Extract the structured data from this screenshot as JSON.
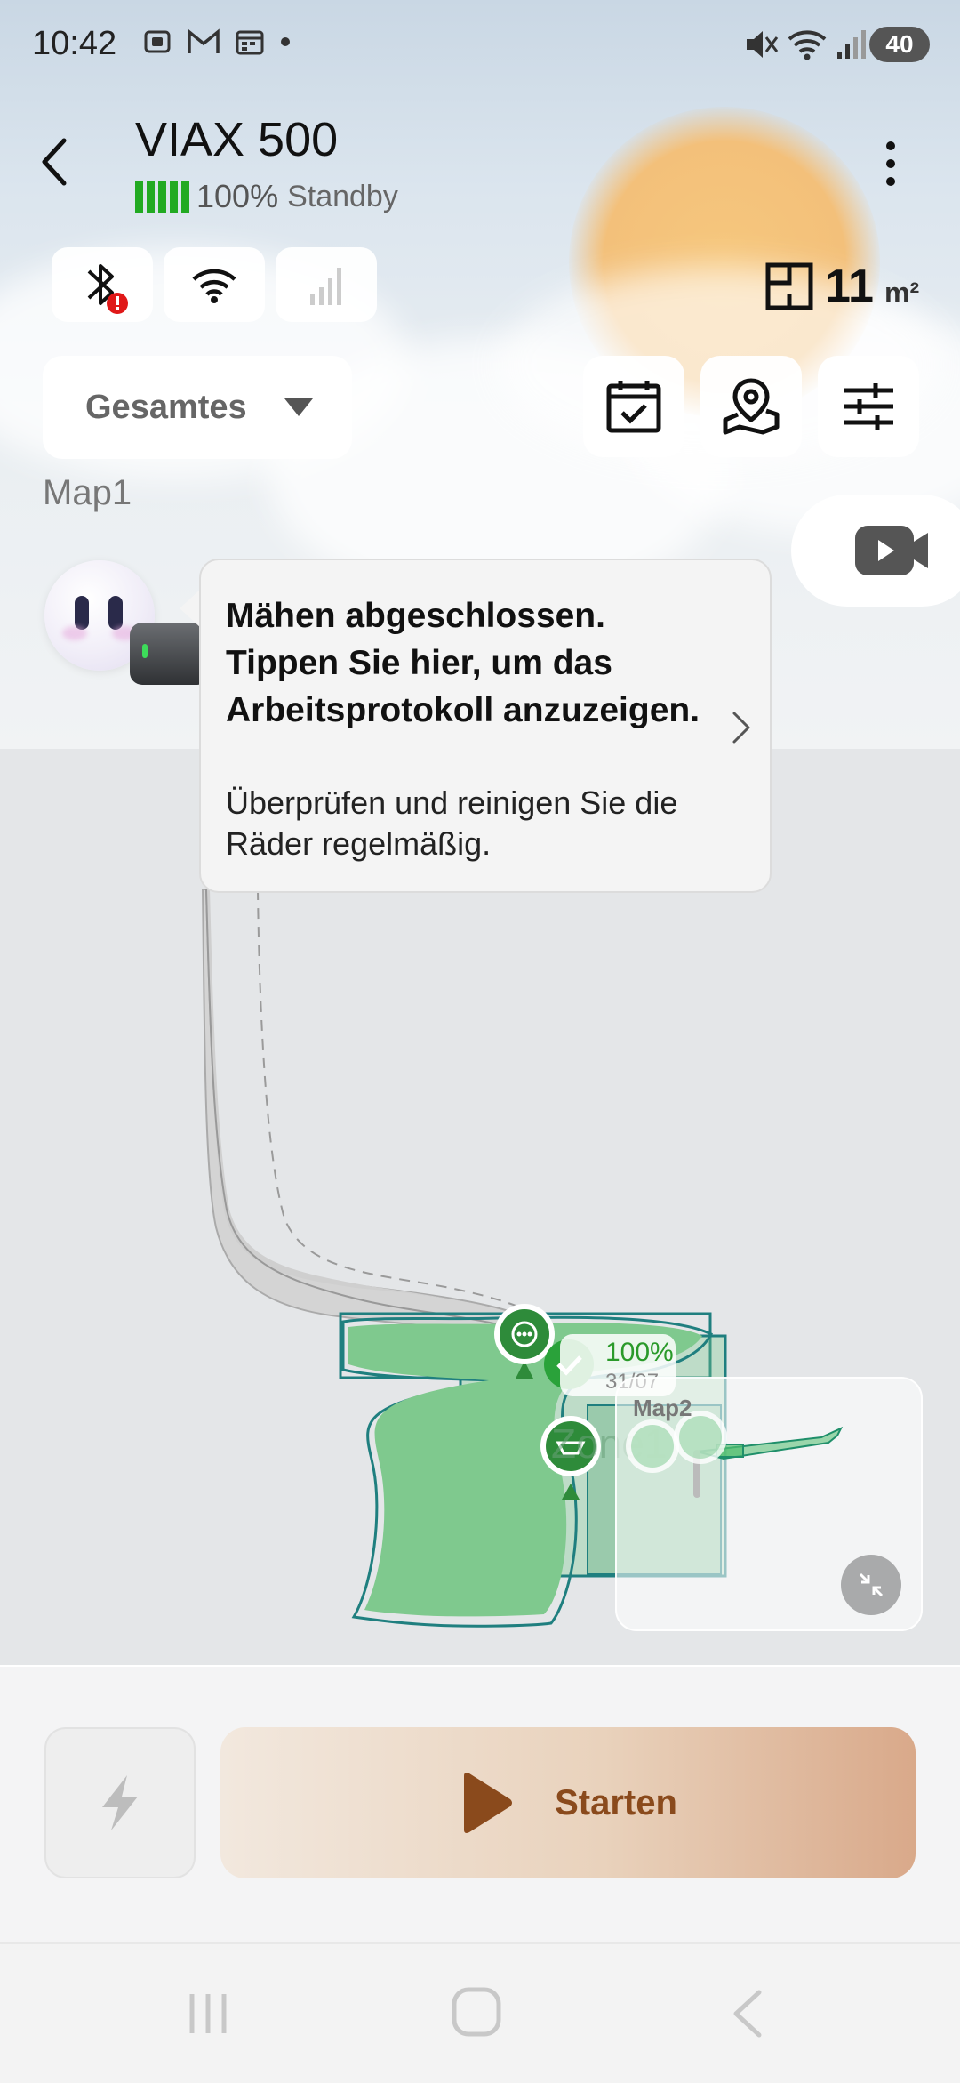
{
  "status_bar": {
    "time": "10:42",
    "battery": "40",
    "signal_label": "5"
  },
  "header": {
    "device_name": "VIAX 500",
    "battery_percent": "100%",
    "state": "Standby",
    "battery_level": 1.0
  },
  "connectivity": {
    "bluetooth": "bluetooth-icon",
    "wifi": "wifi-icon",
    "cellular": "cellular-signal-icon"
  },
  "area": {
    "value": "11",
    "unit": "m²"
  },
  "zone_selector": {
    "selected": "Gesamtes"
  },
  "map_name": "Map1",
  "message": {
    "title": "Mähen abgeschlossen. Tippen Sie hier, um das Arbeitsprotokoll anzuzeigen.",
    "subtitle": "Überprüfen und reinigen Sie die Räder regelmäßig."
  },
  "map": {
    "progress": "100%",
    "date": "31/07",
    "zone_name": "Zone1",
    "secondary_map": "Map2"
  },
  "actions": {
    "start_label": "Starten"
  },
  "colors": {
    "accent_green": "#2e8b3a",
    "battery_green": "#22aa22",
    "start_text": "#8a4a1c"
  }
}
